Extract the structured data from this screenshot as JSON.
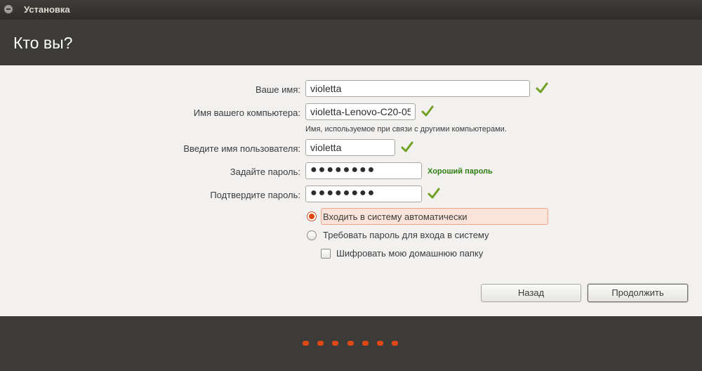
{
  "window": {
    "title": "Установка"
  },
  "page": {
    "title": "Кто вы?"
  },
  "form": {
    "name_label": "Ваше имя:",
    "name_value": "violetta",
    "computer_label": "Имя вашего компьютера:",
    "computer_value": "violetta-Lenovo-C20-05",
    "computer_hint": "Имя, используемое при связи с другими компьютерами.",
    "username_label": "Введите имя пользователя:",
    "username_value": "violetta",
    "password_label": "Задайте пароль:",
    "password_value": "●●●●●●●●",
    "password_strength": "Хороший пароль",
    "confirm_label": "Подтвердите пароль:",
    "confirm_value": "●●●●●●●●"
  },
  "login_options": {
    "auto_login": "Входить в систему автоматически",
    "require_password": "Требовать пароль для входа в систему",
    "encrypt_home": "Шифровать мою домашнюю папку",
    "selected": "auto_login",
    "encrypt_checked": false
  },
  "buttons": {
    "back": "Назад",
    "continue": "Продолжить"
  },
  "progress": {
    "total_steps": 7
  },
  "colors": {
    "accent": "#dd4814",
    "header_bg": "#3c3b37",
    "strength": "#2e7d0e"
  }
}
